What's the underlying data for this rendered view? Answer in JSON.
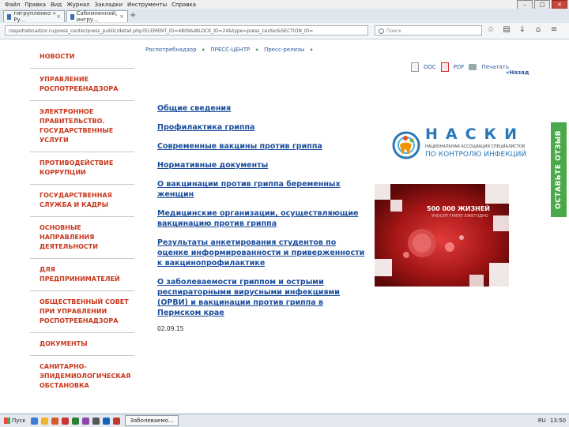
{
  "browser": {
    "menu": [
      "Файл",
      "Правка",
      "Вид",
      "Журнал",
      "Закладки",
      "Инструменты",
      "Справка"
    ],
    "tabs": [
      {
        "title": "гигрупленко « Ру..."
      },
      {
        "title": "Сабниненной, ингру..."
      }
    ],
    "new_tab": "+",
    "url": "rospotrebnadzor.ru/press_center/press_public/detail.php?ELEMENT_ID=4809&IBLOCK_ID=24&type=press_center&SECTION_ID=",
    "search_placeholder": "Поиск",
    "nav_icons": [
      "☆",
      "▤",
      "↓",
      "⌂",
      "≡"
    ],
    "window_buttons": [
      "–",
      "□",
      "✕"
    ]
  },
  "sidebar": {
    "items": [
      {
        "label": "НОВОСТИ"
      },
      {
        "label": "УПРАВЛЕНИЕ РОСПОТРЕБНАДЗОРА"
      },
      {
        "label": "ЭЛЕКТРОННОЕ ПРАВИТЕЛЬСТВО. ГОСУДАРСТВЕННЫЕ УСЛУГИ"
      },
      {
        "label": "ПРОТИВОДЕЙСТВИЕ КОРРУПЦИИ"
      },
      {
        "label": "ГОСУДАРСТВЕННАЯ СЛУЖБА И КАДРЫ"
      },
      {
        "label": "ОСНОВНЫЕ НАПРАВЛЕНИЯ ДЕЯТЕЛЬНОСТИ"
      },
      {
        "label": "ДЛЯ ПРЕДПРИНИМАТЕЛЕЙ"
      },
      {
        "label": "ОБЩЕСТВЕННЫЙ СОВЕТ ПРИ УПРАВЛЕНИИ РОСПОТРЕБНАДЗОРА"
      },
      {
        "label": "ДОКУМЕНТЫ"
      },
      {
        "label": "САНИТАРНО-ЭПИДЕМИОЛОГИЧЕСКАЯ ОБСТАНОВКА"
      }
    ]
  },
  "breadcrumbs": [
    "Роспотребнадзор",
    "ПРЕСС-ЦЕНТР",
    "Пресс-релизы"
  ],
  "tools": {
    "doc": "DOC",
    "pdf": "PDF",
    "print": "Печатать",
    "back": "«Назад"
  },
  "links": [
    "Общие сведения",
    "Профилактика гриппа",
    "Современные вакцины против гриппа",
    "Нормативные документы",
    "О вакцинации против гриппа беременных женщин",
    "Медицинские организации, осуществляющие вакцинацию против гриппа",
    "Результаты анкетирования студентов по оценке информированности и приверженности к вакцинопрофилактике",
    "О заболеваемости гриппом и острыми респираторными вирусными инфекциями (ОРВИ) и вакцинации против гриппа в Пермском крае"
  ],
  "date": "02.09.15",
  "naski": {
    "letters": "НАСКИ",
    "subtitle": "НАЦИОНАЛЬНАЯ АССОЦИАЦИЯ СПЕЦИАЛИСТОВ",
    "subtitle2": "ПО КОНТРОЛЮ ИНФЕКЦИЙ"
  },
  "banner": {
    "title": "500 000 ЖИЗНЕЙ",
    "subtitle": "УНОСИТ ГРИПП ЕЖЕГОДНО"
  },
  "feedback": {
    "label": "ОСТАВЬТЕ ОТЗЫВ"
  },
  "taskbar": {
    "start": "Пуск",
    "task": "Заболеваемо...",
    "lang": "RU",
    "time": "13:50"
  },
  "colors": {
    "accent_red": "#c8371c",
    "link_blue": "#1a4d9c",
    "feedback_green": "#4aa94a"
  }
}
